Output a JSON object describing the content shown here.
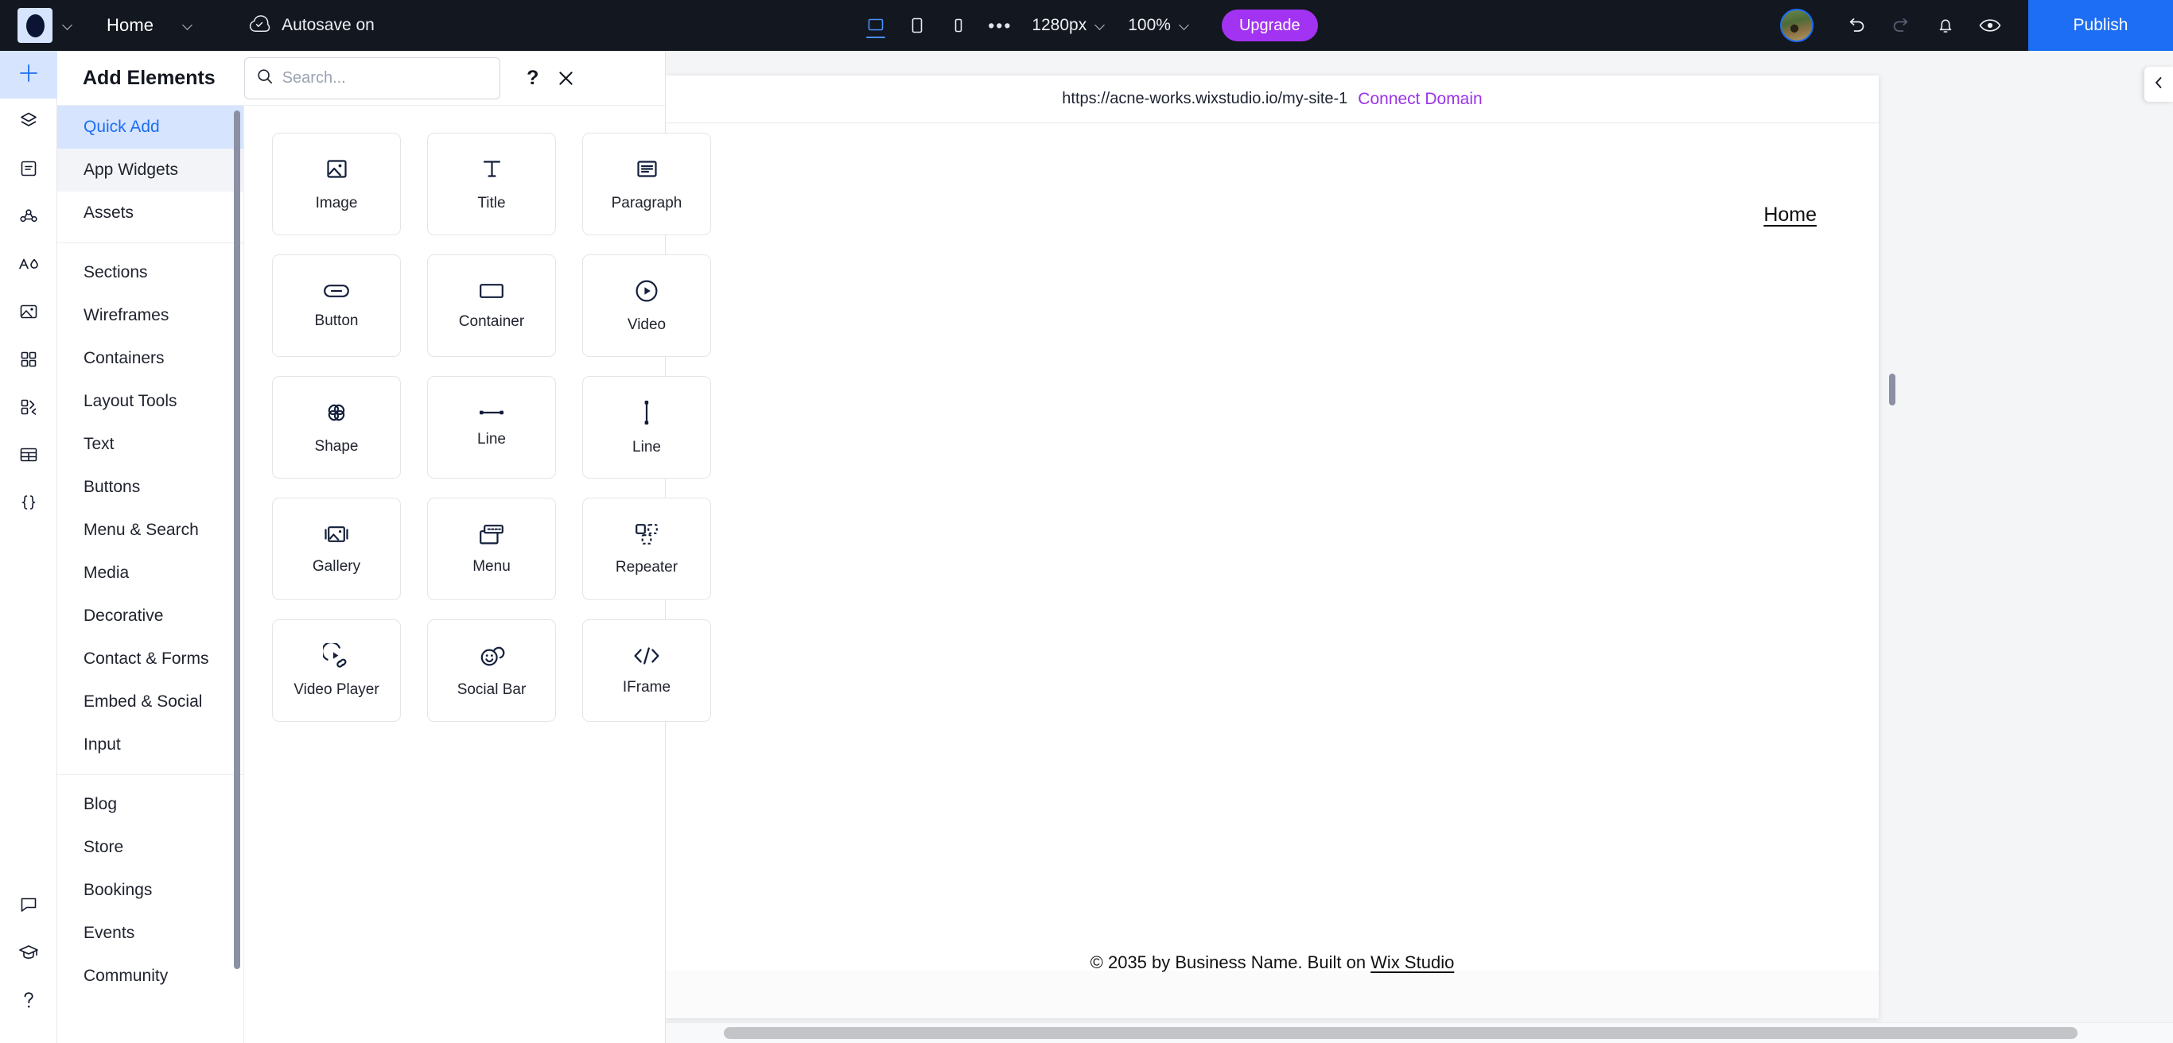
{
  "topbar": {
    "logo_icon": "wix-studio-logo",
    "logo_chevron_icon": "chevron-down-icon",
    "page_name": "Home",
    "page_chevron_icon": "chevron-down-icon",
    "autosave_icon": "cloud-check-icon",
    "autosave_label": "Autosave on",
    "devices": [
      {
        "name": "desktop",
        "icon": "desktop-icon",
        "selected": true
      },
      {
        "name": "tablet",
        "icon": "tablet-icon",
        "selected": false
      },
      {
        "name": "mobile",
        "icon": "mobile-icon",
        "selected": false
      }
    ],
    "more_icon": "ellipsis-icon",
    "breakpoint_value": "1280px",
    "zoom_value": "100%",
    "upgrade_label": "Upgrade",
    "avatar_icon": "user-avatar",
    "undo_icon": "undo-icon",
    "redo_icon": "redo-icon",
    "notifications_icon": "bell-icon",
    "preview_icon": "eye-icon",
    "publish_label": "Publish",
    "accent_blue": "#1d6ef5",
    "accent_purple": "#a333f2",
    "bg": "#131720"
  },
  "rail": {
    "items": [
      {
        "icon": "add-elements-icon",
        "name": "add-elements",
        "active": true
      },
      {
        "icon": "layers-icon",
        "name": "layers",
        "active": false
      },
      {
        "icon": "pages-icon",
        "name": "pages",
        "active": false
      },
      {
        "icon": "cms-icon",
        "name": "cms",
        "active": false
      },
      {
        "icon": "theme-icon",
        "name": "site-theme",
        "active": false
      },
      {
        "icon": "media-icon",
        "name": "media",
        "active": false
      },
      {
        "icon": "apps-icon",
        "name": "apps",
        "active": false
      },
      {
        "icon": "integrations-icon",
        "name": "integrations",
        "active": false
      },
      {
        "icon": "tables-icon",
        "name": "tables",
        "active": false
      },
      {
        "icon": "dev-mode-icon",
        "name": "dev-mode",
        "active": false
      }
    ],
    "bottom_items": [
      {
        "icon": "chat-icon",
        "name": "chat"
      },
      {
        "icon": "academy-icon",
        "name": "academy"
      },
      {
        "icon": "help-icon",
        "name": "help"
      }
    ]
  },
  "panel": {
    "title": "Add Elements",
    "search": {
      "value": "",
      "placeholder": "Search...",
      "icon": "search-icon"
    },
    "help_icon": "question-mark-icon",
    "close_icon": "close-icon",
    "categories_group_1": [
      {
        "label": "Quick Add",
        "state": "selected"
      },
      {
        "label": "App Widgets",
        "state": "hover"
      },
      {
        "label": "Assets",
        "state": "normal"
      }
    ],
    "categories_group_2": [
      {
        "label": "Sections",
        "state": "normal"
      },
      {
        "label": "Wireframes",
        "state": "normal"
      },
      {
        "label": "Containers",
        "state": "normal"
      },
      {
        "label": "Layout Tools",
        "state": "normal"
      },
      {
        "label": "Text",
        "state": "normal"
      },
      {
        "label": "Buttons",
        "state": "normal"
      },
      {
        "label": "Menu & Search",
        "state": "normal"
      },
      {
        "label": "Media",
        "state": "normal"
      },
      {
        "label": "Decorative",
        "state": "normal"
      },
      {
        "label": "Contact & Forms",
        "state": "normal"
      },
      {
        "label": "Embed & Social",
        "state": "normal"
      },
      {
        "label": "Input",
        "state": "normal"
      }
    ],
    "categories_group_3": [
      {
        "label": "Blog",
        "state": "normal"
      },
      {
        "label": "Store",
        "state": "normal"
      },
      {
        "label": "Bookings",
        "state": "normal"
      },
      {
        "label": "Events",
        "state": "normal"
      },
      {
        "label": "Community",
        "state": "normal"
      }
    ],
    "tiles": [
      {
        "label": "Image",
        "icon": "image-icon"
      },
      {
        "label": "Title",
        "icon": "title-text-icon"
      },
      {
        "label": "Paragraph",
        "icon": "paragraph-icon"
      },
      {
        "label": "Button",
        "icon": "button-icon"
      },
      {
        "label": "Container",
        "icon": "container-icon"
      },
      {
        "label": "Video",
        "icon": "video-play-icon"
      },
      {
        "label": "Shape",
        "icon": "shape-clover-icon"
      },
      {
        "label": "Line",
        "icon": "horizontal-line-icon"
      },
      {
        "label": "Line",
        "icon": "vertical-line-icon"
      },
      {
        "label": "Gallery",
        "icon": "gallery-icon"
      },
      {
        "label": "Menu",
        "icon": "menu-bar-icon"
      },
      {
        "label": "Repeater",
        "icon": "repeater-icon"
      },
      {
        "label": "Video Player",
        "icon": "video-player-icon"
      },
      {
        "label": "Social Bar",
        "icon": "social-bar-icon"
      },
      {
        "label": "IFrame",
        "icon": "iframe-code-icon"
      }
    ]
  },
  "stage": {
    "url": "https://acne-works.wixstudio.io/my-site-1",
    "connect_domain_label": "Connect Domain",
    "connect_domain_color": "#9b33e8",
    "site_nav_label": "Home",
    "footer_prefix": "© 2035 by Business Name. Built on ",
    "footer_link": "Wix Studio",
    "collapse_icon": "chevron-left-icon"
  }
}
